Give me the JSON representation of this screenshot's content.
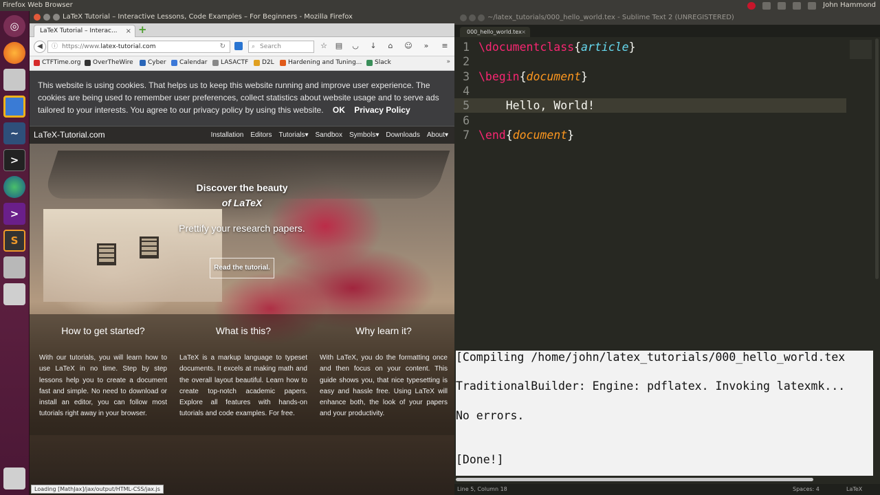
{
  "top_panel": {
    "app_name": "Firefox Web Browser",
    "user": "John Hammond"
  },
  "firefox": {
    "window_title": "LaTeX Tutorial – Interactive Lessons, Code Examples – For Beginners - Mozilla Firefox",
    "tab_title": "LaTeX Tutorial – Interac...",
    "tab_close": "×",
    "new_tab": "+",
    "url_prefix": "https://www.",
    "url_domain": "latex-tutorial.com",
    "search_placeholder": "Search",
    "bookmarks": [
      "CTFTime.org",
      "OverTheWire",
      "Cyber",
      "Calendar",
      "LASACTF",
      "D2L",
      "Hardening and Tuning...",
      "Slack"
    ],
    "bookmark_colors": [
      "#d62b2b",
      "#333333",
      "#2a66b8",
      "#3b78d8",
      "#888888",
      "#e0a020",
      "#e05a1a",
      "#3a8f5a"
    ],
    "status_text": "Loading [MathJax]/jax/output/HTML-CSS/jax.js"
  },
  "page": {
    "cookie_text": "This website is using cookies. That helps us to keep this website running and improve user experience. The cookies are being used to remember user preferences, collect statistics about website usage and to serve ads tailored to your interests. You agree to our privacy policy by using this website.",
    "cookie_ok": "OK",
    "cookie_policy": "Privacy Policy",
    "brand": "LaTeX-Tutorial.com",
    "nav": [
      "Installation",
      "Editors",
      "Tutorials▾",
      "Sandbox",
      "Symbols▾",
      "Downloads",
      "About▾"
    ],
    "hero_line1": "Discover the beauty",
    "hero_line2": "of LaTeX",
    "hero_sub": "Prettify your research papers.",
    "hero_button": "Read the tutorial.",
    "features": [
      {
        "title": "How to get started?",
        "text": "With our tutorials, you will learn how to use LaTeX in no time. Step by step lessons help you to create a document fast and simple. No need to download or install an editor, you can follow most tutorials right away in your browser."
      },
      {
        "title": "What is this?",
        "text": "LaTeX is a markup language to typeset documents. It excels at making math and the overall layout beautiful. Learn how to create top-notch academic papers. Explore all features with hands-on tutorials and code examples. For free."
      },
      {
        "title": "Why learn it?",
        "text": "With LaTeX, you do the formatting once and then focus on your content. This guide shows you, that nice typesetting is easy and hassle free. Using LaTeX will enhance both, the look of your papers and your productivity."
      }
    ]
  },
  "sublime": {
    "window_title": "~/latex_tutorials/000_hello_world.tex - Sublime Text 2 (UNREGISTERED)",
    "tab_name": "000_hello_world.tex",
    "tab_close": "×",
    "code": {
      "l1_cmd": "\\documentclass",
      "l1_open": "{",
      "l1_arg": "article",
      "l1_close": "}",
      "l3_cmd": "\\begin",
      "l3_open": "{",
      "l3_arg": "document",
      "l3_close": "}",
      "l5_text": "    Hello, World!",
      "l7_cmd": "\\end",
      "l7_open": "{",
      "l7_arg": "document",
      "l7_close": "}"
    },
    "line_numbers": [
      "1",
      "2",
      "3",
      "4",
      "5",
      "6",
      "7"
    ],
    "console": [
      "[Compiling /home/john/latex_tutorials/000_hello_world.tex",
      "TraditionalBuilder: Engine: pdflatex. Invoking latexmk...",
      "No errors.",
      "[Done!]"
    ],
    "status_left": "Line 5, Column 18",
    "status_spaces": "Spaces: 4",
    "status_syntax": "LaTeX"
  }
}
